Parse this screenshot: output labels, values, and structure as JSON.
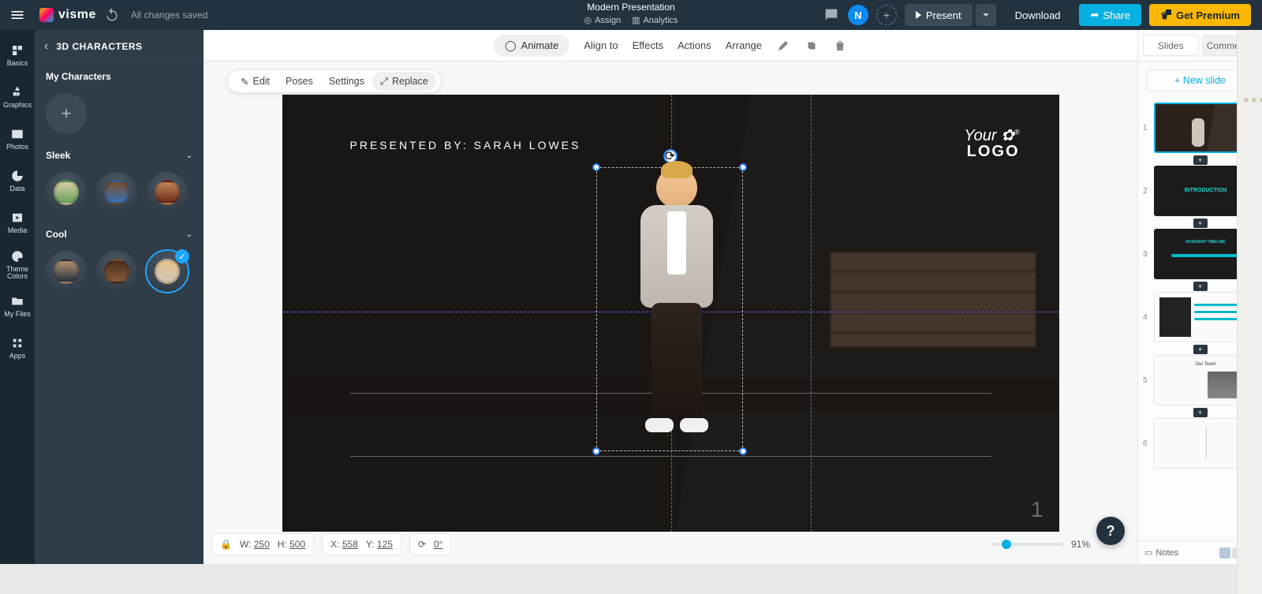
{
  "header": {
    "brand": "visme",
    "save_state": "All changes saved",
    "doc_title": "Modern Presentation",
    "assign": "Assign",
    "analytics": "Analytics",
    "user_initial": "N",
    "present": "Present",
    "download": "Download",
    "share": "Share",
    "premium": "Get Premium"
  },
  "iconcol": {
    "basics": "Basics",
    "graphics": "Graphics",
    "photos": "Photos",
    "data": "Data",
    "media": "Media",
    "theme": "Theme Colors",
    "files": "My Files",
    "apps": "Apps"
  },
  "sidepanel": {
    "title": "3D CHARACTERS",
    "my_chars": "My Characters",
    "group_sleek": "Sleek",
    "group_cool": "Cool"
  },
  "object_toolbar": {
    "animate": "Animate",
    "align": "Align to",
    "effects": "Effects",
    "actions": "Actions",
    "arrange": "Arrange"
  },
  "float_toolbar": {
    "edit": "Edit",
    "poses": "Poses",
    "settings": "Settings",
    "replace": "Replace"
  },
  "slide": {
    "presented_by_label": "PRESENTED BY: ",
    "presented_by_value": "SARAH LOWES",
    "logo_line1": "Your",
    "logo_line2": "LOGO",
    "page_num": "1"
  },
  "status": {
    "w_label": "W:",
    "w": "250",
    "h_label": "H:",
    "h": "500",
    "x_label": "X:",
    "x": "558",
    "y_label": "Y:",
    "y": "125",
    "r_label": "",
    "r": "0°",
    "zoom": "91%"
  },
  "rightrail": {
    "tab_slides": "Slides",
    "tab_comments": "Comments",
    "new_slide": "+ New slide",
    "notes": "Notes",
    "thumb2_title": "INTRODUCTION",
    "thumb3_title": "ROADMAP TIMELINE",
    "thumb5_title": "Our Team",
    "n1": "1",
    "n2": "2",
    "n3": "3",
    "n4": "4",
    "n5": "5",
    "n6": "6"
  }
}
